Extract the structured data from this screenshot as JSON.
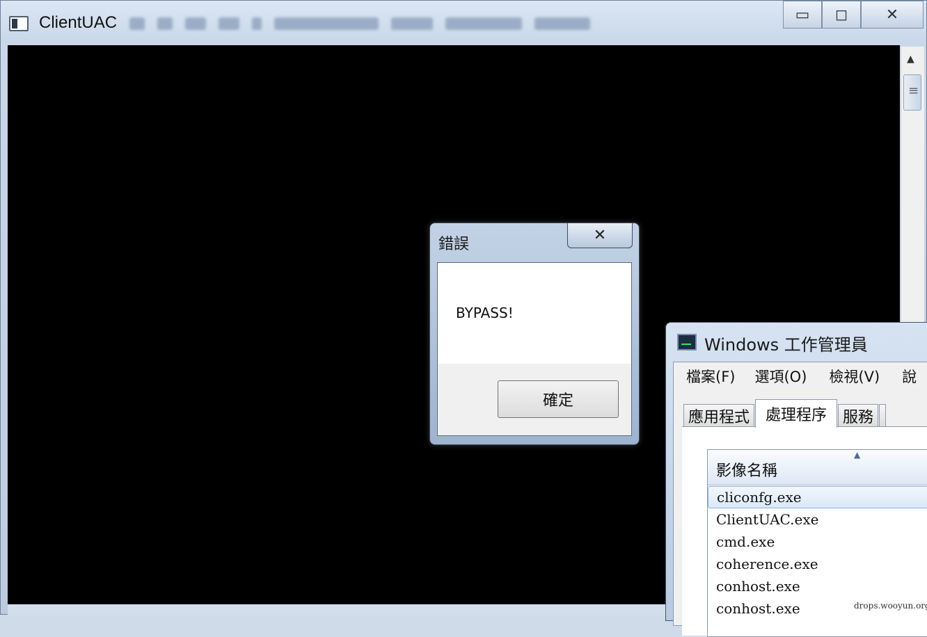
{
  "main_window": {
    "title": "ClientUAC",
    "caption": {
      "minimize": "▭",
      "maximize": "◻",
      "close": "✕"
    }
  },
  "error_dialog": {
    "title": "錯誤",
    "close_label": "✕",
    "message": "BYPASS!",
    "ok_label": "確定"
  },
  "task_manager": {
    "title": "Windows 工作管理員",
    "menu": [
      "檔案(F)",
      "選項(O)",
      "檢視(V)",
      "說"
    ],
    "tabs": [
      "應用程式",
      "處理程序",
      "服務"
    ],
    "active_tab": "處理程序",
    "column_header": "影像名稱",
    "sort_indicator": "▲",
    "processes": [
      "cliconfg.exe",
      "ClientUAC.exe",
      "cmd.exe",
      "coherence.exe",
      "conhost.exe",
      "conhost.exe"
    ],
    "selected_process": "cliconfg.exe"
  },
  "watermark": "drops.wooyun.org"
}
